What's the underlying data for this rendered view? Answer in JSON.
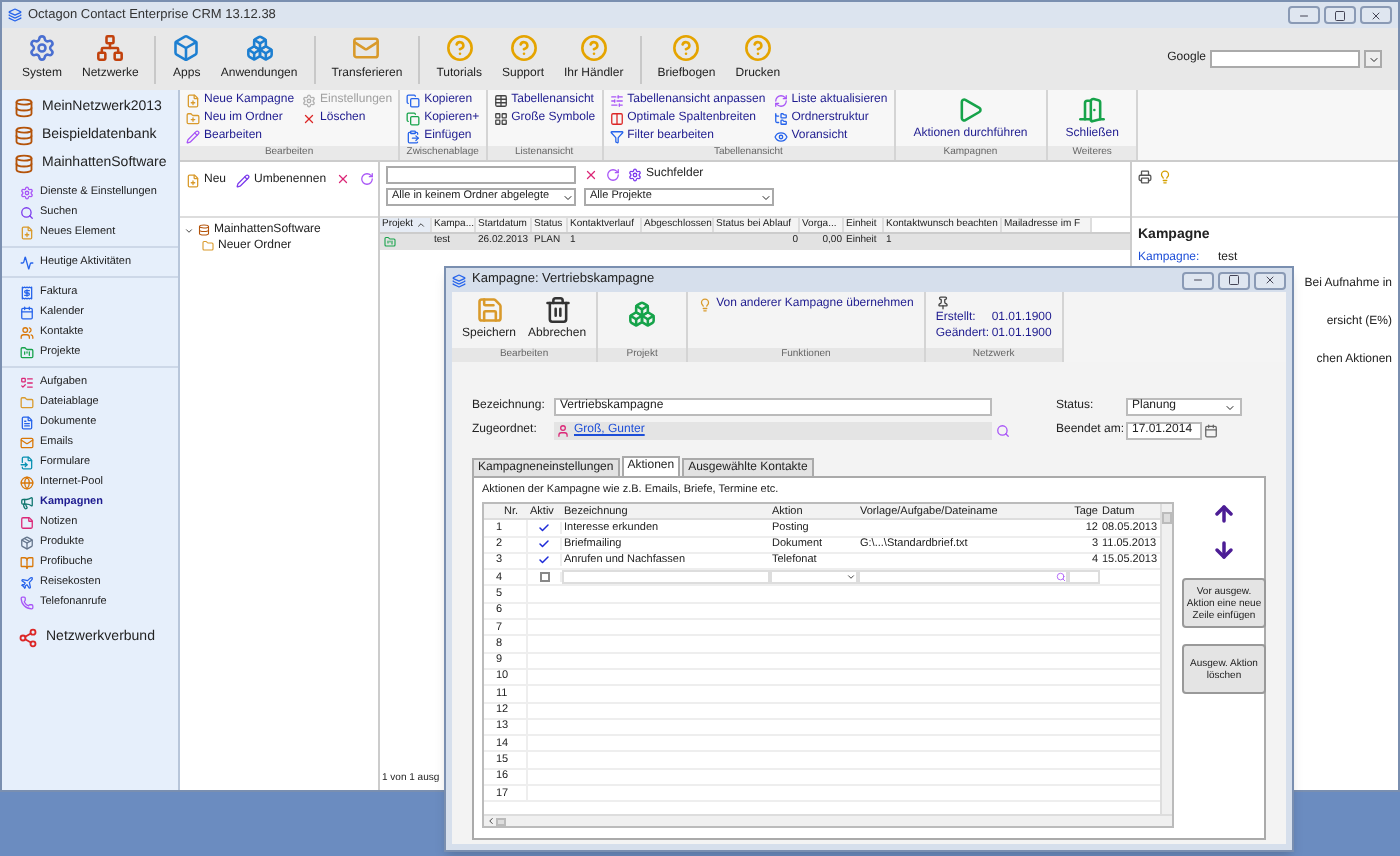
{
  "window": {
    "title": "Octagon Contact Enterprise CRM 13.12.38"
  },
  "toolbar": [
    "System",
    "Netzwerke",
    "Apps",
    "Anwendungen",
    "Transferieren",
    "Tutorials",
    "Support",
    "Ihr Händler",
    "Briefbogen",
    "Drucken"
  ],
  "google": {
    "label": "Google"
  },
  "ribbon": {
    "groups": [
      {
        "title": "Bearbeiten",
        "kind": "small",
        "columns": [
          [
            {
              "label": "Neue Kampagne",
              "disabled": false
            },
            {
              "label": "Neu im Ordner",
              "disabled": false
            },
            {
              "label": "Bearbeiten",
              "disabled": false
            }
          ],
          [
            {
              "label": "Einstellungen",
              "disabled": true
            },
            {
              "label": "Löschen",
              "disabled": false
            }
          ]
        ]
      },
      {
        "title": "Zwischenablage",
        "kind": "small",
        "columns": [
          [
            {
              "label": "Kopieren",
              "disabled": false
            },
            {
              "label": "Kopieren+",
              "disabled": false
            },
            {
              "label": "Einfügen",
              "disabled": false
            }
          ]
        ]
      },
      {
        "title": "Listenansicht",
        "kind": "small",
        "columns": [
          [
            {
              "label": "Tabellenansicht",
              "disabled": false
            },
            {
              "label": "Große Symbole",
              "disabled": false
            }
          ]
        ]
      },
      {
        "title": "Tabellenansicht",
        "kind": "small",
        "columns": [
          [
            {
              "label": "Tabellenansicht anpassen",
              "disabled": false
            },
            {
              "label": "Optimale Spaltenbreiten",
              "disabled": false
            },
            {
              "label": "Filter bearbeiten",
              "disabled": false
            }
          ],
          [
            {
              "label": "Liste aktualisieren",
              "disabled": false
            },
            {
              "label": "Ordnerstruktur",
              "disabled": false
            },
            {
              "label": "Voransicht",
              "disabled": false
            }
          ]
        ]
      },
      {
        "title": "Kampagnen",
        "kind": "large",
        "columns": [
          [
            {
              "label": "Aktionen durchführen",
              "disabled": false
            }
          ]
        ]
      },
      {
        "title": "Weiteres",
        "kind": "large",
        "columns": [
          [
            {
              "label": "Schließen",
              "disabled": false
            }
          ]
        ]
      }
    ]
  },
  "sidebar": {
    "databases": [
      "MeinNetzwerk2013",
      "Beispieldatenbank",
      "MainhattenSoftware"
    ],
    "sections": [
      {
        "items": [
          {
            "label": "Dienste & Einstellungen",
            "selected": false
          },
          {
            "label": "Suchen",
            "selected": false
          },
          {
            "label": "Neues Element",
            "selected": false
          }
        ]
      },
      {
        "items": [
          {
            "label": "Heutige Aktivitäten",
            "selected": false
          }
        ]
      },
      {
        "items": [
          {
            "label": "Faktura",
            "selected": false
          },
          {
            "label": "Kalender",
            "selected": false
          },
          {
            "label": "Kontakte",
            "selected": false
          },
          {
            "label": "Projekte",
            "selected": false
          }
        ]
      },
      {
        "items": [
          {
            "label": "Aufgaben",
            "selected": false
          },
          {
            "label": "Dateiablage",
            "selected": false
          },
          {
            "label": "Dokumente",
            "selected": false
          },
          {
            "label": "Emails",
            "selected": false
          },
          {
            "label": "Formulare",
            "selected": false
          },
          {
            "label": "Internet-Pool",
            "selected": false
          },
          {
            "label": "Kampagnen",
            "selected": true
          },
          {
            "label": "Notizen",
            "selected": false
          },
          {
            "label": "Produkte",
            "selected": false
          },
          {
            "label": "Profibuche",
            "selected": false
          },
          {
            "label": "Reisekosten",
            "selected": false
          },
          {
            "label": "Telefonanrufe",
            "selected": false
          }
        ]
      }
    ],
    "network": "Netzwerkverbund"
  },
  "folders": {
    "buttons": [
      "Neu",
      "Umbenennen"
    ],
    "tree": [
      {
        "label": "MainhattenSoftware",
        "expanded": true,
        "children": [
          {
            "label": "Neuer Ordner"
          }
        ]
      }
    ]
  },
  "list": {
    "search_button": "Suchfelder",
    "filter": "Alle in keinem Ordner abgelegte",
    "project": "Alle Projekte",
    "columns": [
      {
        "label": "Projekt",
        "sorted": true
      },
      {
        "label": "Kampa...",
        "sorted": false
      },
      {
        "label": "Startdatum",
        "sorted": false
      },
      {
        "label": "Status",
        "sorted": false
      },
      {
        "label": "Kontaktverlauf",
        "sorted": false
      },
      {
        "label": "Abgeschlossen",
        "sorted": false
      },
      {
        "label": "Status bei Ablauf",
        "sorted": false
      },
      {
        "label": "Vorga...",
        "sorted": false
      },
      {
        "label": "Einheit",
        "sorted": false
      },
      {
        "label": "Kontaktwunsch beachten",
        "sorted": false
      },
      {
        "label": "Mailadresse im F",
        "sorted": false
      }
    ],
    "rows": [
      {
        "selected": true,
        "cells": [
          "",
          "test",
          "26.02.2013",
          "PLAN",
          "1",
          "",
          "0",
          "0,00",
          "Einheit",
          "1",
          ""
        ]
      }
    ],
    "status": "1 von 1 ausg"
  },
  "details": {
    "title": "Kampagne",
    "fields": [
      {
        "label": "Kampagne:",
        "value": "test"
      }
    ],
    "fragments": [
      "Bei Aufnahme in",
      "ersicht (E%)",
      "chen Aktionen"
    ]
  },
  "dialog": {
    "title": "Kampagne: Vertriebskampagne",
    "groups": [
      {
        "title": "Bearbeiten",
        "buttons": [
          "Speichern",
          "Abbrechen"
        ]
      },
      {
        "title": "Projekt"
      },
      {
        "title": "Funktionen",
        "buttons": [
          "Von anderer Kampagne übernehmen"
        ]
      },
      {
        "title": "Netzwerk",
        "fields": [
          {
            "label": "Erstellt:",
            "value": "01.01.1900"
          },
          {
            "label": "Geändert:",
            "value": "01.01.1900"
          }
        ]
      }
    ],
    "form": {
      "name_label": "Bezeichnung:",
      "name": "Vertriebskampagne",
      "assigned_label": "Zugeordnet:",
      "assigned": "Groß, Gunter",
      "status_label": "Status:",
      "status": "Planung",
      "end_label": "Beendet am:",
      "end": "17.01.2014"
    },
    "tabs": [
      {
        "label": "Kampagneneinstellungen",
        "selected": false
      },
      {
        "label": "Aktionen",
        "selected": true
      },
      {
        "label": "Ausgewählte Kontakte",
        "selected": false
      }
    ],
    "description": "Aktionen der Kampagne wie z.B. Emails, Briefe, Termine etc.",
    "columns": [
      "Nr.",
      "Aktiv",
      "Bezeichnung",
      "Aktion",
      "Vorlage/Aufgabe/Dateiname",
      "Tage",
      "Datum"
    ],
    "rows": [
      {
        "kind": "entry",
        "nr": "1",
        "active": true,
        "name": "Interesse erkunden",
        "action": "Posting",
        "days": "12",
        "date": "08.05.2013"
      },
      {
        "kind": "entry",
        "nr": "2",
        "active": true,
        "name": "Briefmailing",
        "action": "Dokument",
        "template": "G:\\...\\Standardbrief.txt",
        "days": "3",
        "date": "11.05.2013"
      },
      {
        "kind": "entry",
        "nr": "3",
        "active": true,
        "name": "Anrufen und Nachfassen",
        "action": "Telefonat",
        "days": "4",
        "date": "15.05.2013"
      },
      {
        "kind": "edit",
        "nr": "4",
        "active": false
      },
      {
        "kind": "empty",
        "nr": "5"
      },
      {
        "kind": "empty",
        "nr": "6"
      },
      {
        "kind": "empty",
        "nr": "7"
      },
      {
        "kind": "empty",
        "nr": "8"
      },
      {
        "kind": "empty",
        "nr": "9"
      },
      {
        "kind": "empty",
        "nr": "10"
      },
      {
        "kind": "empty",
        "nr": "11"
      },
      {
        "kind": "empty",
        "nr": "12"
      },
      {
        "kind": "empty",
        "nr": "13"
      },
      {
        "kind": "empty",
        "nr": "14"
      },
      {
        "kind": "empty",
        "nr": "15"
      },
      {
        "kind": "empty",
        "nr": "16"
      },
      {
        "kind": "empty",
        "nr": "17"
      }
    ],
    "buttons": [
      "Vor ausgew. Aktion eine neue Zeile einfügen",
      "Ausgew. Aktion löschen"
    ]
  }
}
